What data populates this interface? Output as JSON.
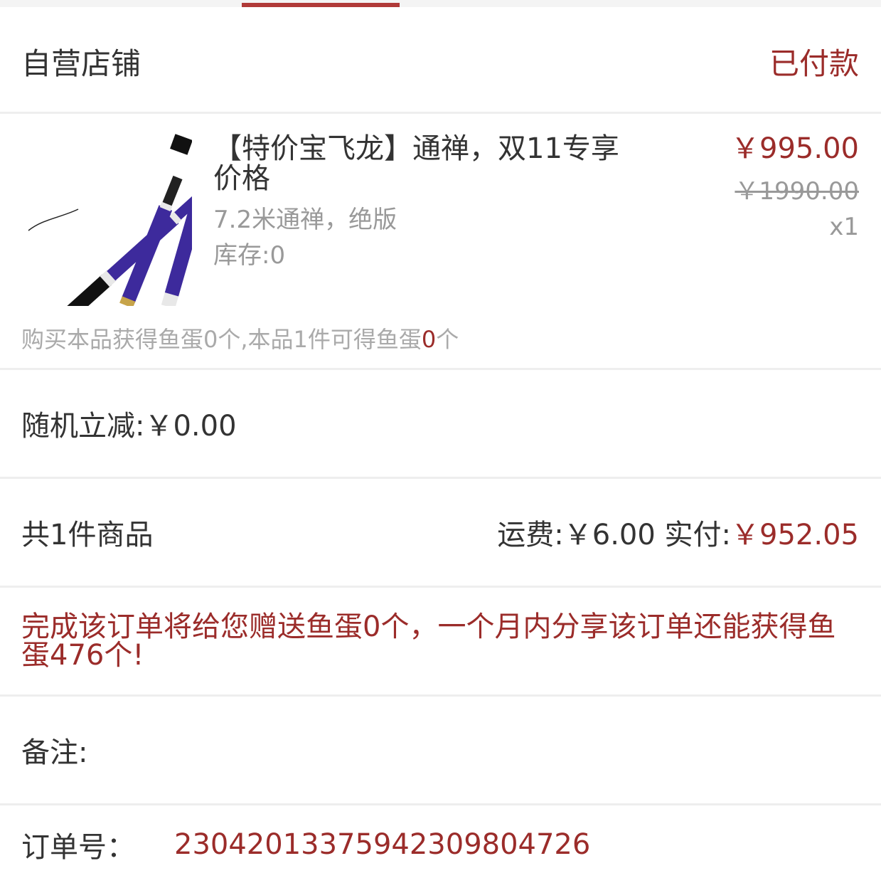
{
  "header": {
    "shop_name": "自营店铺",
    "status": "已付款"
  },
  "product": {
    "title": "【特价宝飞龙】通禅，双11专享价格",
    "spec": "7.2米通禅，绝版",
    "stock": "库存:0",
    "price": "￥995.00",
    "original_price": "￥1990.00",
    "quantity": "x1",
    "image": "fishing-rod-image"
  },
  "reward": {
    "prefix": "购买本品获得鱼蛋0个,本品1件可得鱼蛋",
    "count": "0",
    "suffix": "个"
  },
  "discount": {
    "label": "随机立减:",
    "value": "￥0.00"
  },
  "summary": {
    "count_text": "共1件商品",
    "shipping_label": "运费:",
    "shipping_value": "￥6.00",
    "paid_label": "实付:",
    "paid_value": "￥952.05"
  },
  "promo": {
    "text": "完成该订单将给您赠送鱼蛋0个，一个月内分享该订单还能获得鱼蛋476个!"
  },
  "remark": {
    "label": "备注:"
  },
  "order": {
    "label": "订单号：",
    "number": "2304201337594230980­4726"
  },
  "colors": {
    "accent": "#9b2c2a",
    "tab_indicator": "#b03a38",
    "muted": "#999999",
    "rod_purple": "#3d2a9c"
  }
}
